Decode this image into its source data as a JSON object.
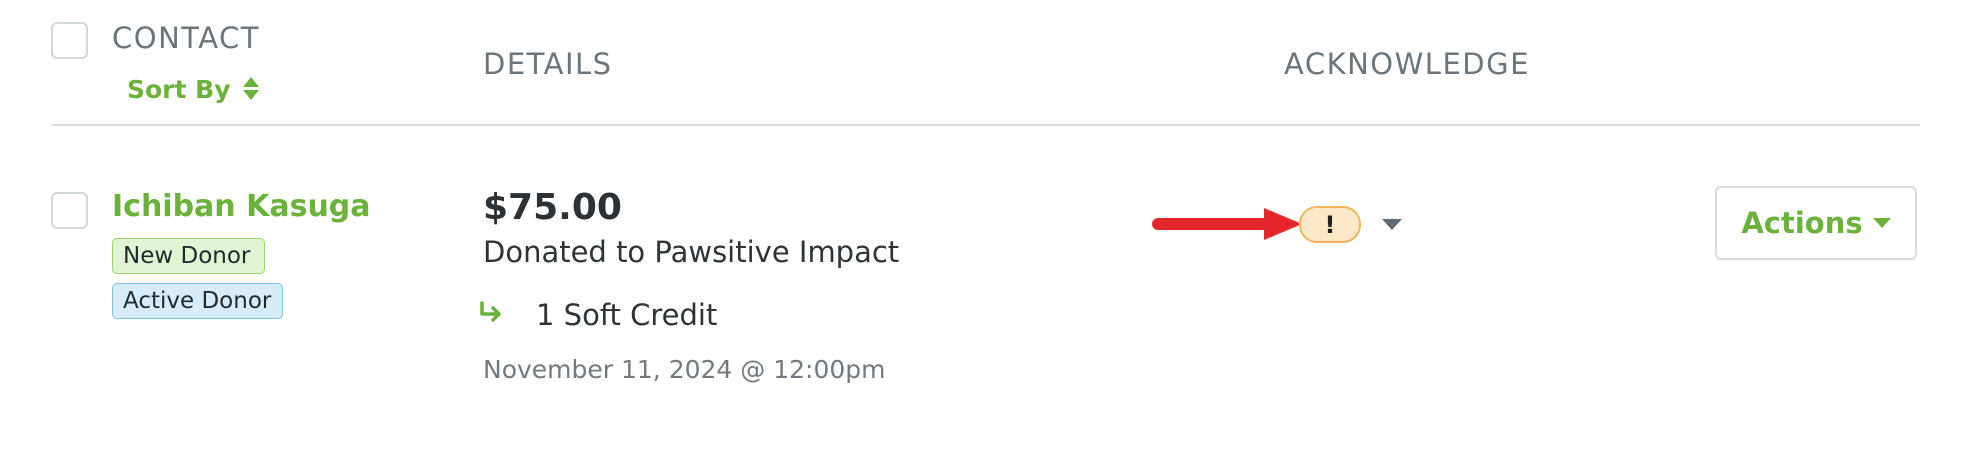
{
  "header": {
    "contact_label": "CONTACT",
    "sort_by_label": "Sort By",
    "details_label": "DETAILS",
    "acknowledge_label": "ACKNOWLEDGE"
  },
  "row": {
    "contact_name": "Ichiban Kasuga",
    "badges": {
      "new_donor": "New Donor",
      "active_donor": "Active Donor"
    },
    "amount": "$75.00",
    "donated_to": "Donated to Pawsitive Impact",
    "soft_credit": "1 Soft Credit",
    "date": "November 11, 2024 @ 12:00pm",
    "acknowledge_status": "!",
    "actions_label": "Actions"
  },
  "colors": {
    "accent_green": "#6ab23a",
    "annotation_arrow": "#e3262b",
    "warning_bg": "#fde9c8",
    "warning_border": "#f2b45a"
  },
  "icons": {
    "sort": "sort-icon",
    "soft_credit": "arrow-return-icon",
    "acknowledge_dropdown": "chevron-down-icon",
    "actions_dropdown": "chevron-down-icon",
    "annotation": "red-arrow-icon"
  }
}
